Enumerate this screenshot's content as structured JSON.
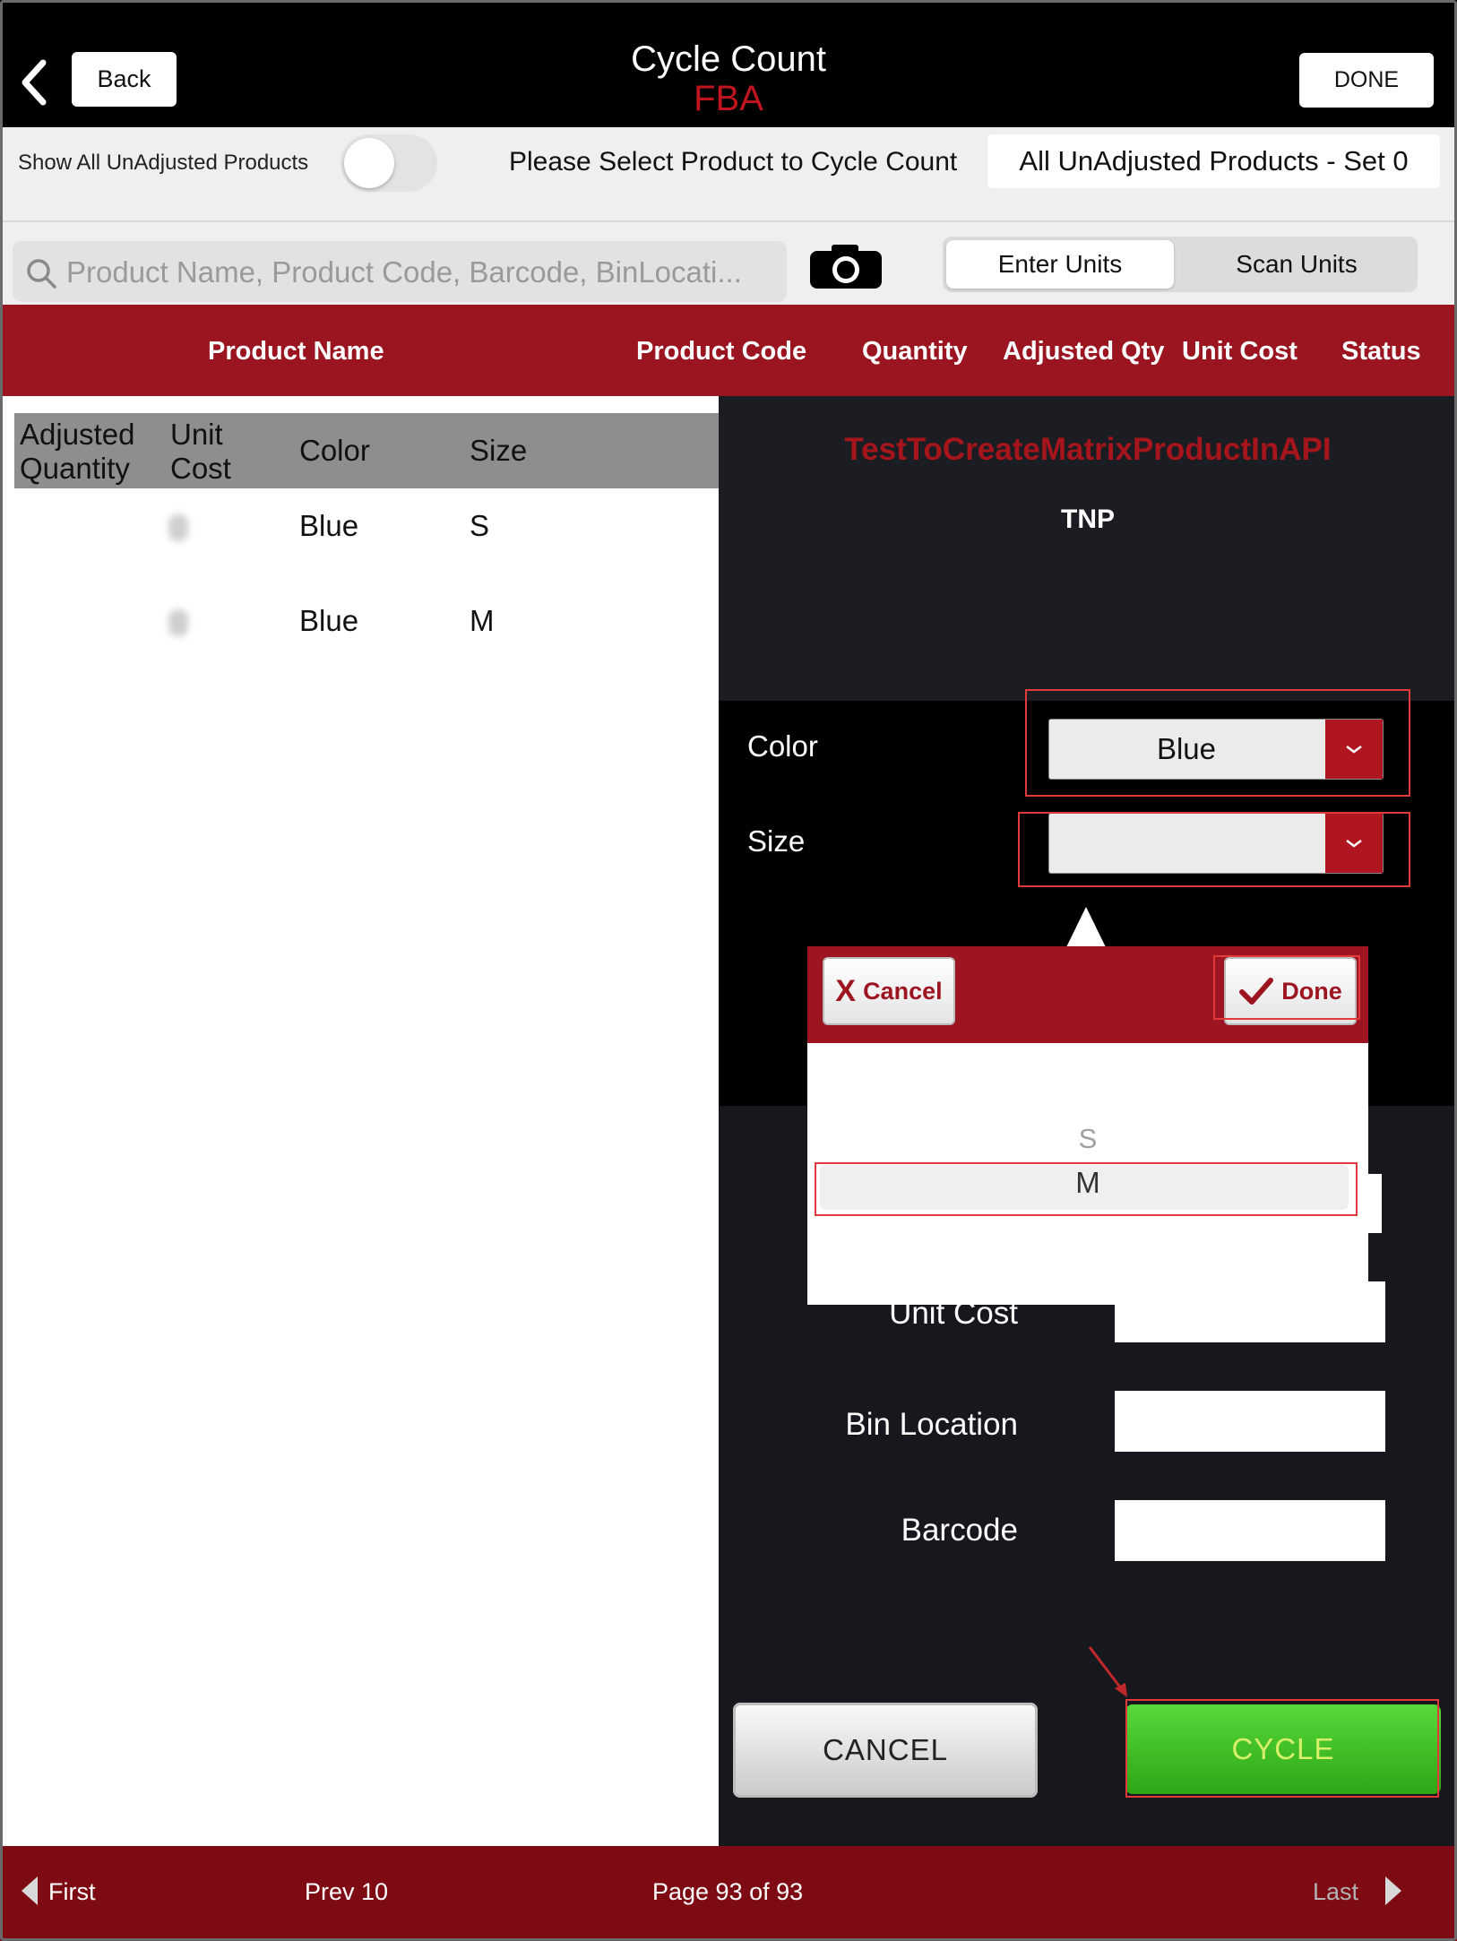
{
  "header": {
    "back_label": "Back",
    "title": "Cycle Count",
    "subtitle": "FBA",
    "done_label": "DONE"
  },
  "filter": {
    "show_unadjusted_label": "Show All UnAdjusted Products",
    "toggle_on": false,
    "select_prompt": "Please Select Product to Cycle Count",
    "set_value": "All UnAdjusted Products - Set 0"
  },
  "search": {
    "placeholder": "Product Name, Product Code, Barcode, BinLocati...",
    "mode_tabs": [
      "Enter Units",
      "Scan Units"
    ],
    "active_mode": "Enter Units"
  },
  "columns": [
    "Product Name",
    "Product Code",
    "Quantity",
    "Adjusted Qty",
    "Unit Cost",
    "Status"
  ],
  "variants": {
    "headers": {
      "adjusted_qty_1": "Adjusted",
      "adjusted_qty_2": "Quantity",
      "unit_cost_1": "Unit",
      "unit_cost_2": "Cost",
      "color": "Color",
      "size": "Size"
    },
    "rows": [
      {
        "color": "Blue",
        "size": "S"
      },
      {
        "color": "Blue",
        "size": "M"
      }
    ]
  },
  "product": {
    "name": "TestToCreateMatrixProductInAPI",
    "code": "TNP"
  },
  "attributes": {
    "color_label": "Color",
    "color_value": "Blue",
    "size_label": "Size",
    "size_value": ""
  },
  "form": {
    "unit_cost_label": "Unit Cost",
    "bin_location_label": "Bin Location",
    "barcode_label": "Barcode"
  },
  "picker": {
    "cancel_label": "Cancel",
    "done_label": "Done",
    "options": [
      "S",
      "M"
    ],
    "selected": "M"
  },
  "actions": {
    "cancel_label": "CANCEL",
    "cycle_label": "CYCLE"
  },
  "pagination": {
    "first_label": "First",
    "prev_label": "Prev 10",
    "page_text": "Page 93 of 93",
    "last_label": "Last"
  },
  "colors": {
    "brand_red": "#9a1520",
    "cycle_green": "#3cbc1f",
    "footer_red": "#7e0b13"
  }
}
